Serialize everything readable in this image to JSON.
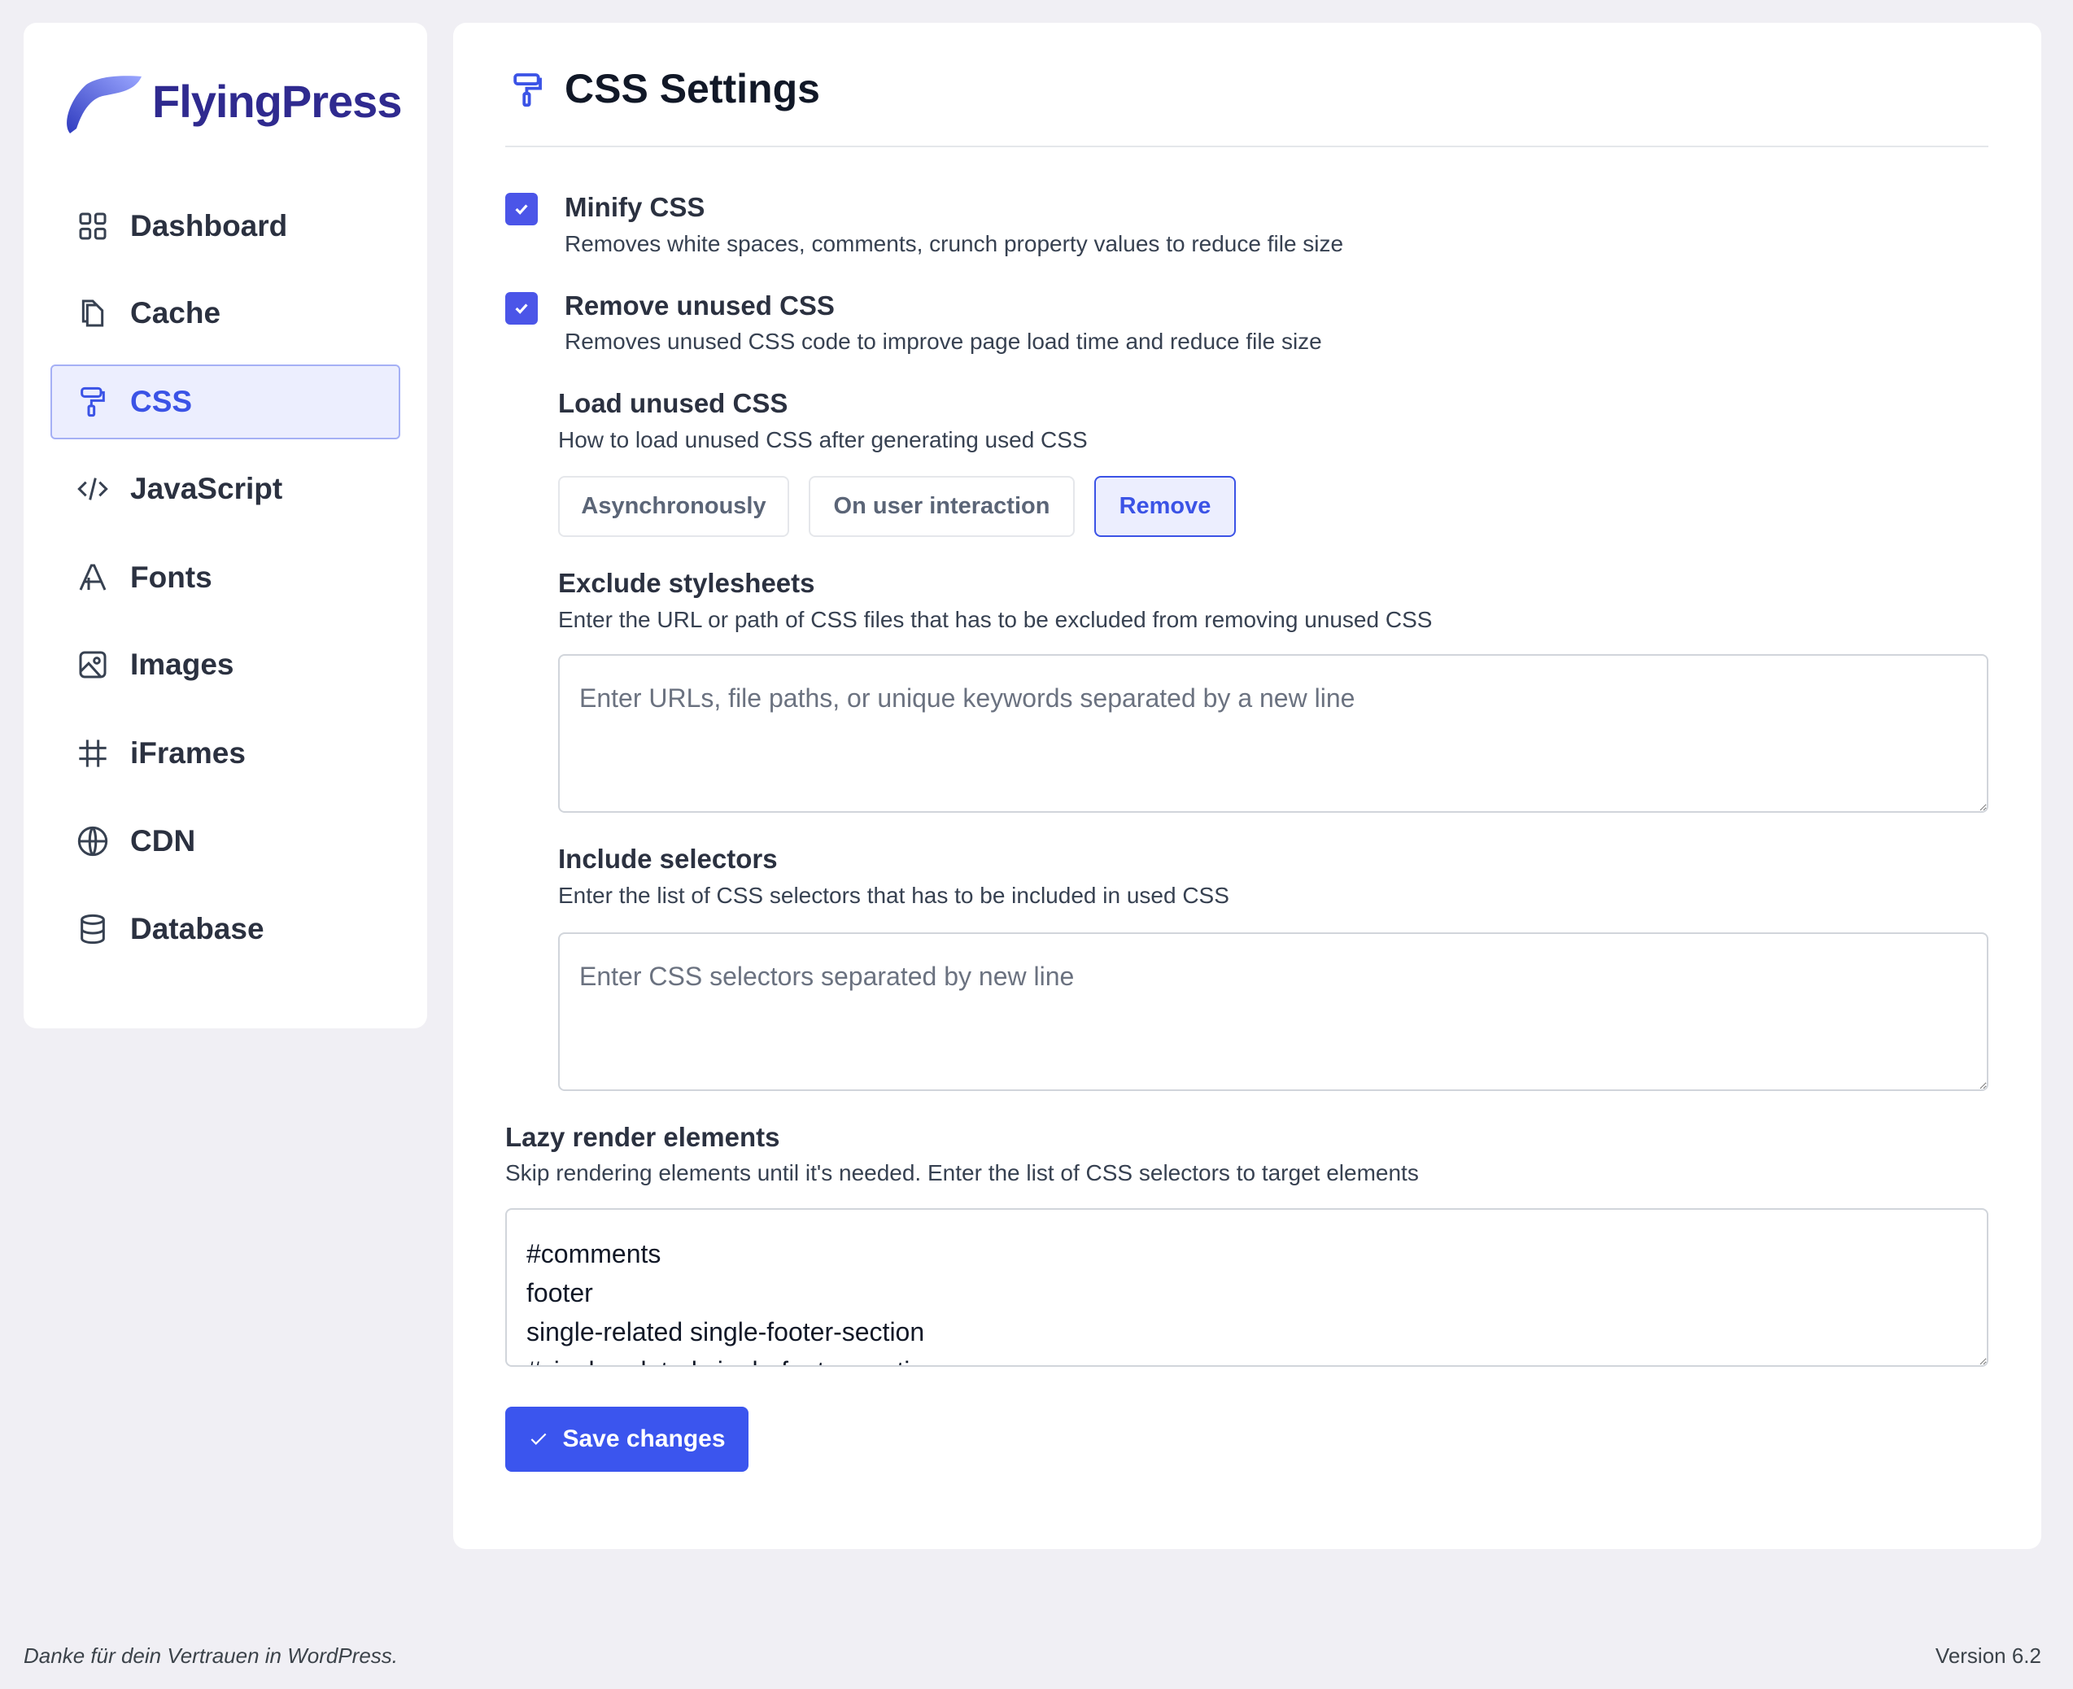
{
  "brand": {
    "name": "FlyingPress"
  },
  "sidebar": {
    "items": [
      {
        "label": "Dashboard",
        "icon": "grid-icon"
      },
      {
        "label": "Cache",
        "icon": "copy-icon"
      },
      {
        "label": "CSS",
        "icon": "paint-roller-icon",
        "active": true
      },
      {
        "label": "JavaScript",
        "icon": "code-icon"
      },
      {
        "label": "Fonts",
        "icon": "font-icon"
      },
      {
        "label": "Images",
        "icon": "image-icon"
      },
      {
        "label": "iFrames",
        "icon": "frame-icon"
      },
      {
        "label": "CDN",
        "icon": "globe-icon"
      },
      {
        "label": "Database",
        "icon": "database-icon"
      }
    ]
  },
  "main": {
    "title": "CSS Settings",
    "minify": {
      "label": "Minify CSS",
      "desc": "Removes white spaces, comments, crunch property values to reduce file size",
      "checked": true
    },
    "remove_unused": {
      "label": "Remove unused CSS",
      "desc": "Removes unused CSS code to improve page load time and reduce file size",
      "checked": true
    },
    "load_unused": {
      "label": "Load unused CSS",
      "desc": "How to load unused CSS after generating used CSS",
      "options": [
        "Asynchronously",
        "On user interaction",
        "Remove"
      ],
      "selected": "Remove"
    },
    "exclude": {
      "label": "Exclude stylesheets",
      "desc": "Enter the URL or path of CSS files that has to be excluded from removing unused CSS",
      "placeholder": "Enter URLs, file paths, or unique keywords separated by a new line"
    },
    "include": {
      "label": "Include selectors",
      "desc": "Enter the list of CSS selectors that has to be included in used CSS",
      "placeholder": "Enter CSS selectors separated by new line"
    },
    "lazy": {
      "label": "Lazy render elements",
      "desc": "Skip rendering elements until it's needed. Enter the list of CSS selectors to target elements",
      "value": "#comments\nfooter\nsingle-related single-footer-section\n#single-related single-footer-section"
    },
    "save_label": "Save changes"
  },
  "footer": {
    "left": "Danke für dein Vertrauen in WordPress.",
    "right": "Version 6.2"
  },
  "colors": {
    "accent": "#3b55ee",
    "brand": "#2f2a8f"
  }
}
